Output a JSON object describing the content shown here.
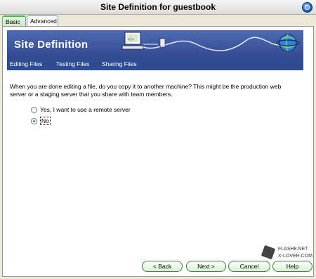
{
  "window": {
    "title": "Site Definition for guestbook"
  },
  "tabs": [
    {
      "label": "Basic"
    },
    {
      "label": "Advanced"
    }
  ],
  "banner": {
    "title": "Site Definition"
  },
  "nav": {
    "items": [
      {
        "label": "Editing Files"
      },
      {
        "label": "Testing Files"
      },
      {
        "label": "Sharing Files"
      }
    ]
  },
  "content": {
    "question": "When you are done editing a file, do you copy it to another machine? This might be the production web server or a staging server that you share with team members.",
    "options": [
      {
        "label": "Yes, I want to use a remote server",
        "checked": false
      },
      {
        "label": "No",
        "checked": true
      }
    ]
  },
  "watermark": {
    "line1": "FLASH8.NET",
    "line2": "X-LOVER.COM"
  },
  "buttons": {
    "back": "< Back",
    "next": "Next >",
    "cancel": "Cancel",
    "help": "Help"
  },
  "colors": {
    "banner": "#34498f",
    "accent_green": "#3cbf3c"
  }
}
